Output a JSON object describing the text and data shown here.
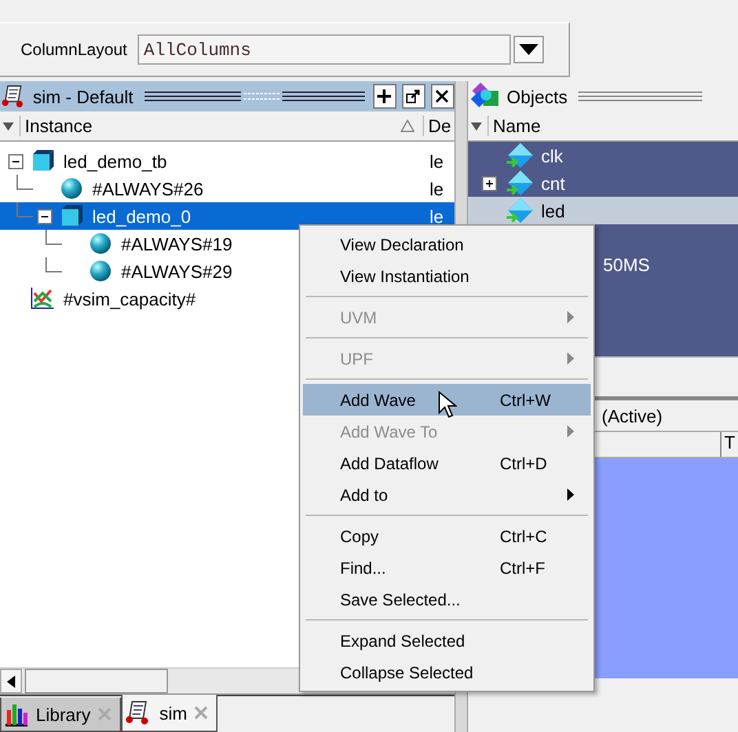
{
  "toolbar": {
    "label": "ColumnLayout",
    "value": "AllColumns"
  },
  "sim_pane": {
    "title": "sim - Default",
    "columns": [
      "Instance",
      "De"
    ],
    "tree": [
      {
        "name": "led_demo_tb",
        "kind": "module",
        "expanded": true,
        "selected": false,
        "design": "le",
        "children": [
          {
            "name": "#ALWAYS#26",
            "kind": "process",
            "selected": false,
            "design": "le"
          },
          {
            "name": "led_demo_0",
            "kind": "module",
            "expanded": true,
            "selected": true,
            "design": "le",
            "children": [
              {
                "name": "#ALWAYS#19",
                "kind": "process",
                "selected": false
              },
              {
                "name": "#ALWAYS#29",
                "kind": "process",
                "selected": false
              }
            ]
          }
        ]
      },
      {
        "name": "#vsim_capacity#",
        "kind": "capacity",
        "selected": false
      }
    ],
    "tabs": [
      {
        "label": "Library",
        "kind": "library",
        "selected": false
      },
      {
        "label": "sim",
        "kind": "sim",
        "selected": true
      }
    ]
  },
  "objects_pane": {
    "title": "Objects",
    "column": "Name",
    "rows": [
      {
        "name": "clk",
        "expanded": null,
        "selected": true
      },
      {
        "name": "cnt",
        "expanded": false,
        "selected": true
      },
      {
        "name": "led",
        "expanded": null,
        "selected": false
      }
    ],
    "value_text": "50MS"
  },
  "wave_pane": {
    "title": "(Active)",
    "column_2": "T"
  },
  "context_menu": [
    {
      "kind": "item",
      "label": "View Declaration",
      "disabled": false,
      "selected": false
    },
    {
      "kind": "item",
      "label": "View Instantiation",
      "disabled": false,
      "selected": false
    },
    {
      "kind": "separator"
    },
    {
      "kind": "item",
      "label": "UVM",
      "disabled": true,
      "submenu": true,
      "selected": false
    },
    {
      "kind": "separator"
    },
    {
      "kind": "item",
      "label": "UPF",
      "disabled": true,
      "submenu": true,
      "selected": false
    },
    {
      "kind": "separator"
    },
    {
      "kind": "item",
      "label": "Add Wave",
      "shortcut": "Ctrl+W",
      "disabled": false,
      "selected": true
    },
    {
      "kind": "item",
      "label": "Add Wave To",
      "disabled": true,
      "submenu": true,
      "selected": false
    },
    {
      "kind": "item",
      "label": "Add Dataflow",
      "shortcut": "Ctrl+D",
      "disabled": false,
      "selected": false
    },
    {
      "kind": "item",
      "label": "Add to",
      "disabled": false,
      "submenu": true,
      "selected": false
    },
    {
      "kind": "separator"
    },
    {
      "kind": "item",
      "label": "Copy",
      "shortcut": "Ctrl+C",
      "disabled": false,
      "selected": false
    },
    {
      "kind": "item",
      "label": "Find...",
      "shortcut": "Ctrl+F",
      "disabled": false,
      "selected": false
    },
    {
      "kind": "item",
      "label": "Save Selected...",
      "disabled": false,
      "selected": false
    },
    {
      "kind": "separator"
    },
    {
      "kind": "item",
      "label": "Expand Selected",
      "disabled": false,
      "selected": false
    },
    {
      "kind": "item",
      "label": "Collapse Selected",
      "disabled": false,
      "selected": false
    }
  ]
}
